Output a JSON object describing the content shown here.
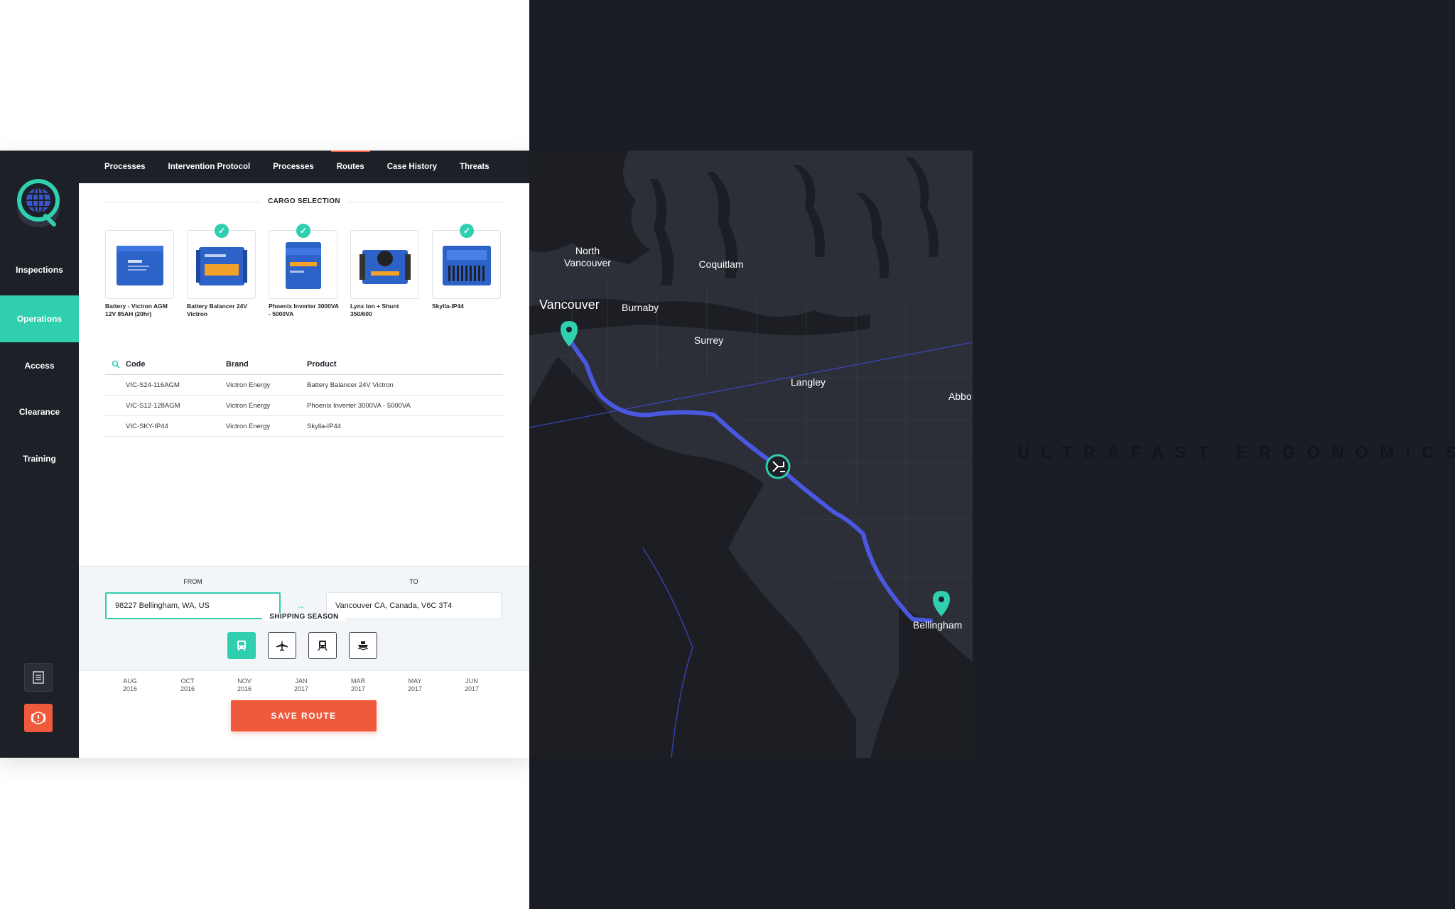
{
  "sidebar": {
    "items": [
      {
        "label": "Inspections",
        "active": false
      },
      {
        "label": "Operations",
        "active": true
      },
      {
        "label": "Access",
        "active": false
      },
      {
        "label": "Clearance",
        "active": false
      },
      {
        "label": "Training",
        "active": false
      }
    ]
  },
  "tabs": [
    {
      "label": "Processes",
      "active": false
    },
    {
      "label": "Intervention Protocol",
      "active": false
    },
    {
      "label": "Processes",
      "active": false
    },
    {
      "label": "Routes",
      "active": true
    },
    {
      "label": "Case History",
      "active": false
    },
    {
      "label": "Threats",
      "active": false
    }
  ],
  "cargo": {
    "title": "CARGO SELECTION",
    "items": [
      {
        "label": "Battery - Victron AGM 12V 85AH (20hr)",
        "selected": false
      },
      {
        "label": "Battery Balancer 24V Victron",
        "selected": true
      },
      {
        "label": "Phoenix Inverter 3000VA - 5000VA",
        "selected": true
      },
      {
        "label": "Lynx Ion + Shunt 350/600",
        "selected": false
      },
      {
        "label": "Skylla-IP44",
        "selected": true
      }
    ]
  },
  "table": {
    "headers": {
      "code": "Code",
      "brand": "Brand",
      "product": "Product"
    },
    "rows": [
      {
        "code": "VIC-S24-116AGM",
        "brand": "Victron Energy",
        "product": "Battery Balancer 24V Victron"
      },
      {
        "code": "VIC-S12-128AGM",
        "brand": "Victron Energy",
        "product": "Phoenix Inverter 3000VA - 5000VA"
      },
      {
        "code": "VIC-SKY-IP44",
        "brand": "Victron Energy",
        "product": "Skylla-IP44"
      }
    ]
  },
  "season": {
    "title": "SHIPPING SEASON",
    "ticks": [
      {
        "month": "AUG",
        "year": "2016"
      },
      {
        "month": "OCT",
        "year": "2016"
      },
      {
        "month": "NOV",
        "year": "2016"
      },
      {
        "month": "JAN",
        "year": "2017"
      },
      {
        "month": "MAR",
        "year": "2017"
      },
      {
        "month": "MAY",
        "year": "2017"
      },
      {
        "month": "JUN",
        "year": "2017"
      }
    ],
    "range_start": "OCT 2016",
    "range_end": "MAY 2017"
  },
  "route": {
    "from_label": "FROM",
    "from_value": "98227 Bellingham, WA, US",
    "to_label": "TO",
    "to_value": "Vancouver CA, Canada, V6C 3T4",
    "modes": [
      {
        "icon": "bus-icon",
        "active": true
      },
      {
        "icon": "plane-icon",
        "active": false
      },
      {
        "icon": "train-icon",
        "active": false
      },
      {
        "icon": "ship-icon",
        "active": false
      }
    ],
    "save_label": "SAVE ROUTE"
  },
  "map": {
    "labels": {
      "north_vancouver": "North Vancouver",
      "coquitlam": "Coquitlam",
      "vancouver": "Vancouver",
      "burnaby": "Burnaby",
      "surrey": "Surrey",
      "langley": "Langley",
      "abbo": "Abbo",
      "bellingham": "Bellingham"
    },
    "route_color": "#4a57e0",
    "pin_color": "#2fcfb0"
  },
  "tagline": "ULTRAFAST ERGONOMICS",
  "colors": {
    "accent": "#2fcfb0",
    "danger": "#ef5a3c",
    "dark": "#1d2027"
  }
}
